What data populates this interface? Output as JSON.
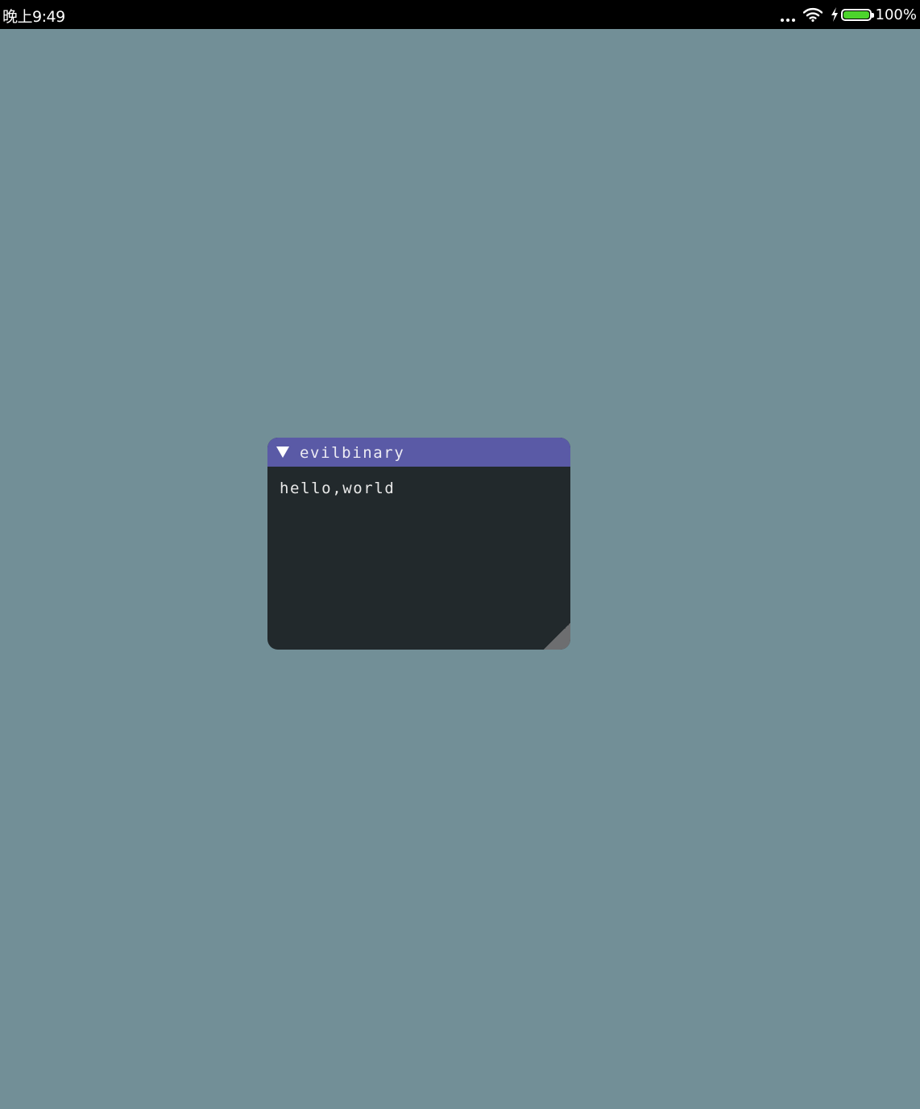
{
  "status_bar": {
    "time": "晚上9:49",
    "battery_percent": "100%",
    "battery_level": 1.0,
    "battery_color": "#4cd42c",
    "icons": [
      "more-dots-icon",
      "wifi-icon",
      "charging-bolt-icon",
      "battery-icon"
    ]
  },
  "window": {
    "title": "evilbinary",
    "body_text": "hello,world",
    "titlebar_color": "#5a5aa6",
    "background_color": "#22292c"
  },
  "background_color": "#728f97"
}
